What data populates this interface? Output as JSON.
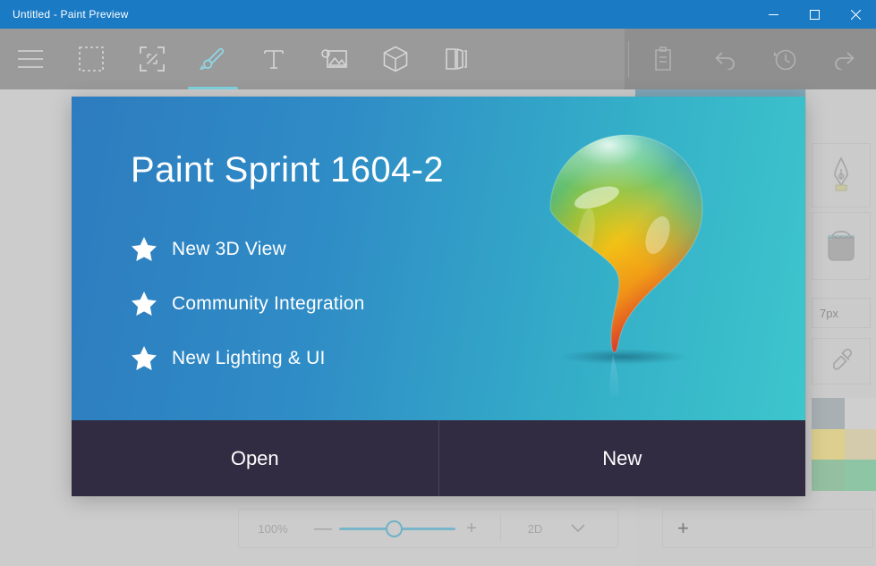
{
  "window": {
    "title": "Untitled - Paint Preview",
    "titlebar_color": "#1a7ac4",
    "controls": [
      {
        "name": "minimize-button",
        "glyph": "minimize"
      },
      {
        "name": "maximize-button",
        "glyph": "maximize"
      },
      {
        "name": "close-button",
        "glyph": "close"
      }
    ]
  },
  "toolbar": {
    "background": "#9a9a9a",
    "active_accent": "#7fd3e0",
    "tools": [
      {
        "name": "menu-icon",
        "label": "Menu",
        "active": false,
        "dim": false
      },
      {
        "name": "select-icon",
        "label": "Select",
        "active": false,
        "dim": false
      },
      {
        "name": "crop-resize-icon",
        "label": "Crop and resize",
        "active": false,
        "dim": false
      },
      {
        "name": "brush-icon",
        "label": "Brushes",
        "active": true,
        "dim": false
      },
      {
        "name": "text-icon",
        "label": "Text",
        "active": false,
        "dim": false
      },
      {
        "name": "effects-icon",
        "label": "Effects",
        "active": false,
        "dim": false
      },
      {
        "name": "cube-3d-icon",
        "label": "3D objects",
        "active": false,
        "dim": false
      },
      {
        "name": "canvas-icon",
        "label": "Canvas",
        "active": false,
        "dim": false
      }
    ],
    "tools_right": [
      {
        "name": "paste-icon",
        "label": "Paste",
        "dim": true
      },
      {
        "name": "undo-icon",
        "label": "Undo",
        "dim": true
      },
      {
        "name": "history-icon",
        "label": "History",
        "dim": true
      },
      {
        "name": "redo-icon",
        "label": "Redo",
        "dim": true
      }
    ]
  },
  "right_panel": {
    "tools": [
      {
        "name": "calligraphy-pen-icon",
        "label": "Calligraphy pen"
      },
      {
        "name": "paint-bucket-icon",
        "label": "Fill with color"
      },
      {
        "name": "eyedropper-icon",
        "label": "Color picker"
      }
    ],
    "brush_size": "7px",
    "swatches": [
      {
        "name": "swatch-gray-dark",
        "color": "#a8b0b4"
      },
      {
        "name": "swatch-gray-light",
        "color": "#cfcfcf"
      },
      {
        "name": "swatch-tan-dark",
        "color": "#ddcf8e"
      },
      {
        "name": "swatch-tan-light",
        "color": "#d4cbad"
      },
      {
        "name": "swatch-green-dark",
        "color": "#94bfa1"
      },
      {
        "name": "swatch-green-light",
        "color": "#8ec5a4"
      }
    ],
    "add_color_label": "+"
  },
  "status_bar": {
    "zoom_value": "100%",
    "zoom_out_label": "—",
    "zoom_in_label": "+",
    "slider_percent": 50,
    "view_mode": "2D",
    "slider_color": "#79b6c9"
  },
  "splash": {
    "title": "Paint Sprint 1604-2",
    "features": [
      {
        "icon": "star-icon",
        "text": "New 3D View"
      },
      {
        "icon": "star-icon",
        "text": "Community Integration"
      },
      {
        "icon": "star-icon",
        "text": "New Lighting & UI"
      }
    ],
    "logo_name": "paint-drop-logo",
    "actions": [
      {
        "name": "open-button",
        "label": "Open"
      },
      {
        "name": "new-button",
        "label": "New"
      }
    ],
    "hero_gradient_from": "#2d7cbf",
    "hero_gradient_to": "#3dc6cc",
    "footer_color": "#322c42"
  }
}
